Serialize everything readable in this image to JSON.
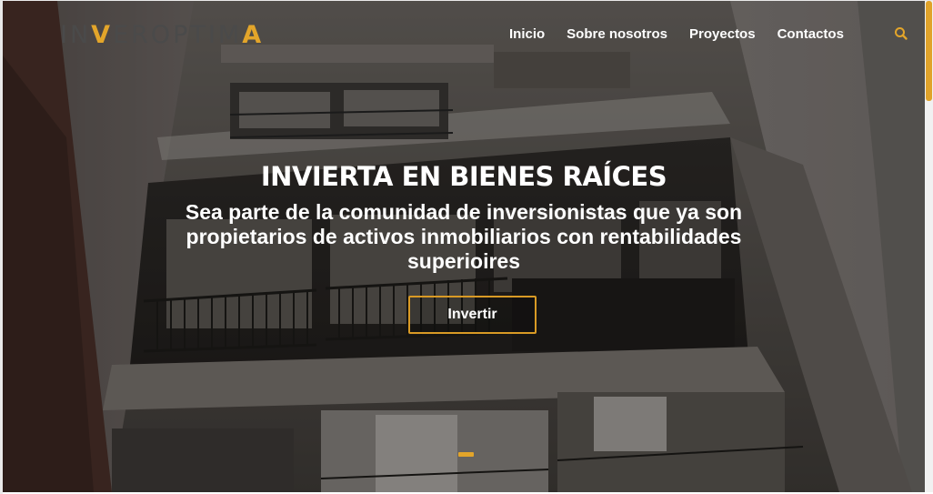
{
  "header": {
    "logo": {
      "part1": "IN",
      "part2": "V",
      "part3": "EROPTIM",
      "part4": "A"
    },
    "nav": [
      {
        "label": "Inicio"
      },
      {
        "label": "Sobre nosotros"
      },
      {
        "label": "Proyectos"
      },
      {
        "label": "Contactos"
      }
    ],
    "search_icon": "search-icon"
  },
  "hero": {
    "headline": "INVIERTA EN BIENES RAÍCES",
    "subtitle": "Sea parte de la comunidad de inversionistas que ya son propietarios de activos inmobiliarios con rentabilidades superioires",
    "cta_label": "Invertir",
    "slides": {
      "current": 1,
      "total": 1
    }
  },
  "colors": {
    "accent": "#e3a52a",
    "text_light": "#ffffff"
  }
}
